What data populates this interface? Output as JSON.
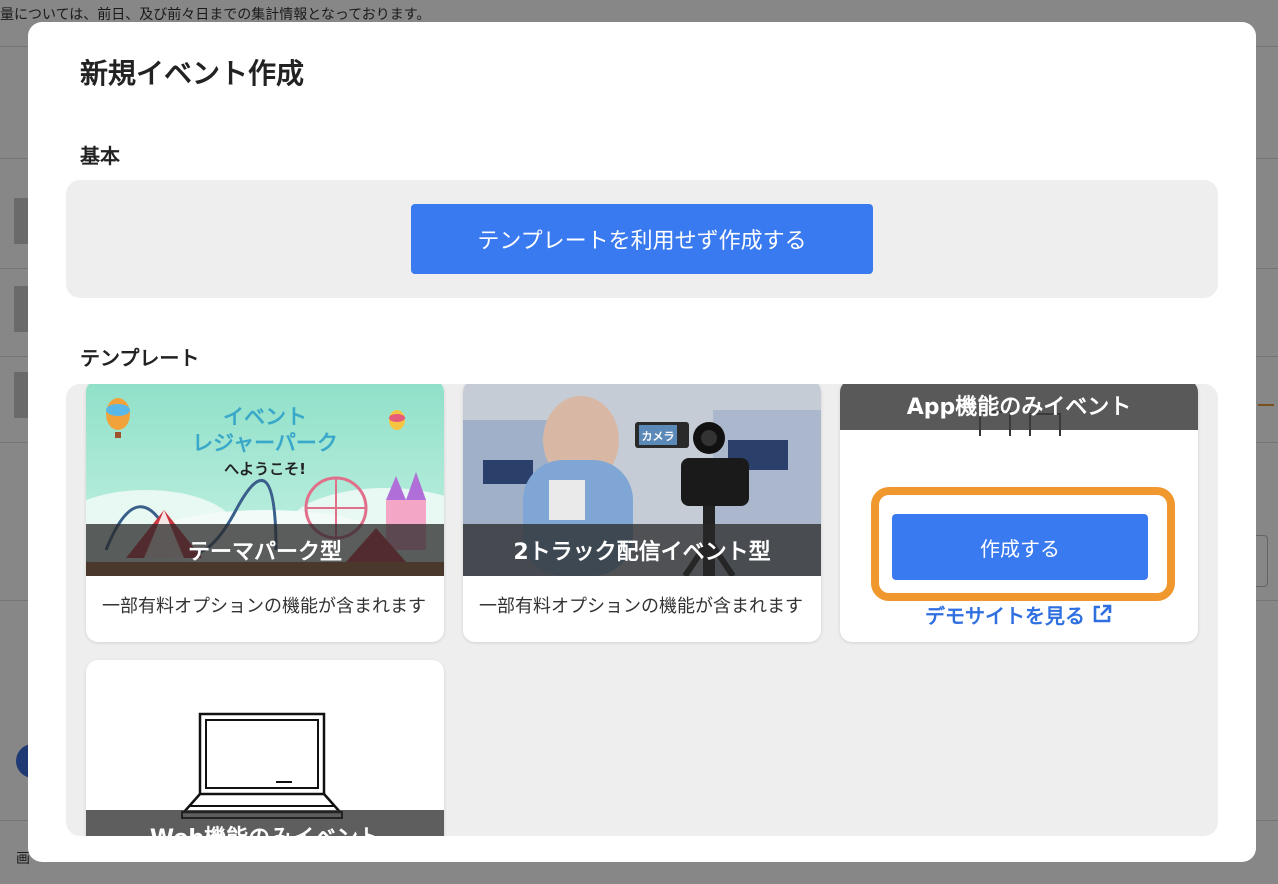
{
  "background": {
    "notice": "量については、前日、及び前々日までの集計情報となっております。",
    "footer_text": "画"
  },
  "modal": {
    "title": "新規イベント作成",
    "basic": {
      "label": "基本",
      "button_label": "テンプレートを利用せず作成する"
    },
    "templates": {
      "label": "テンプレート",
      "cards": [
        {
          "title": "テーマパーク型",
          "description": "一部有料オプションの機能が含まれます",
          "image_text": [
            "イベント",
            "レジャーパーク",
            "へようこそ!"
          ],
          "icon": "theme-park-illustration"
        },
        {
          "title": "2トラック配信イベント型",
          "description": "一部有料オプションの機能が含まれます",
          "image_text": [
            "カメラ"
          ],
          "icon": "video-camera-photo"
        },
        {
          "title": "App機能のみイベント",
          "create_label": "作成する",
          "demo_label": "デモサイトを見る",
          "icon": "external-link-icon"
        },
        {
          "title": "Web機能のみイベント",
          "icon": "laptop-icon"
        }
      ]
    }
  },
  "colors": {
    "primary": "#3a7af0",
    "highlight": "#f0982e",
    "link": "#2f6fe0",
    "panel_bg": "#eeeeee"
  }
}
